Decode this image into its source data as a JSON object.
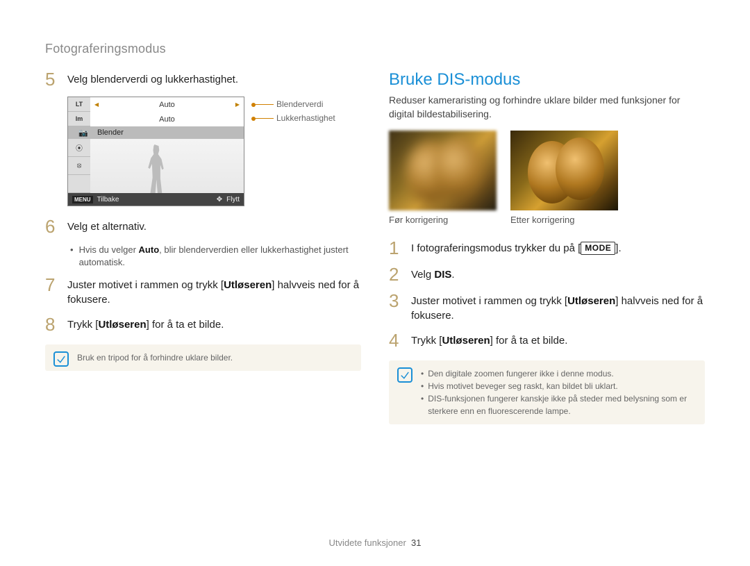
{
  "section_label": "Fotograferingsmodus",
  "left": {
    "step5": "Velg blenderverdi og lukkerhastighet.",
    "lcd": {
      "icons": [
        "LT",
        "Im",
        "📷",
        "⦿",
        "⦻"
      ],
      "row_blender": "Blender",
      "val1": "Auto",
      "val2": "Auto",
      "foot_back": "Tilbake",
      "foot_move": "Flytt",
      "menu": "MENU"
    },
    "anno_blender": "Blenderverdi",
    "anno_shutter": "Lukkerhastighet",
    "step6": "Velg et alternativ.",
    "step6_sub_a": "Hvis du velger ",
    "step6_sub_bold": "Auto",
    "step6_sub_b": ", blir blenderverdien eller lukkerhastighet justert automatisk.",
    "step7_a": "Juster motivet i rammen og trykk [",
    "step7_bold": "Utløseren",
    "step7_b": "] halvveis ned for å fokusere.",
    "step8_a": "Trykk [",
    "step8_bold": "Utløseren",
    "step8_b": "] for å ta et bilde.",
    "note": "Bruk en tripod for å forhindre uklare bilder."
  },
  "right": {
    "heading": "Bruke DIS-modus",
    "intro": "Reduser kameraristing og forhindre uklare bilder med funksjoner for digital bildestabilisering.",
    "cap_before": "Før korrigering",
    "cap_after": "Etter korrigering",
    "step1_a": "I fotograferingsmodus trykker du på [",
    "step1_mode": "MODE",
    "step1_b": "].",
    "step2_a": "Velg ",
    "step2_bold": "DIS",
    "step2_b": ".",
    "step3_a": "Juster motivet i rammen og trykk [",
    "step3_bold": "Utløseren",
    "step3_b": "] halvveis ned for å fokusere.",
    "step4_a": "Trykk [",
    "step4_bold": "Utløseren",
    "step4_b": "] for å ta et bilde.",
    "note_items": [
      "Den digitale zoomen fungerer ikke i denne modus.",
      "Hvis motivet beveger seg raskt, kan bildet bli uklart.",
      "DIS-funksjonen fungerer kanskje ikke på steder med belysning som er sterkere enn en fluorescerende lampe."
    ]
  },
  "footer_label": "Utvidete funksjoner",
  "footer_page": "31"
}
